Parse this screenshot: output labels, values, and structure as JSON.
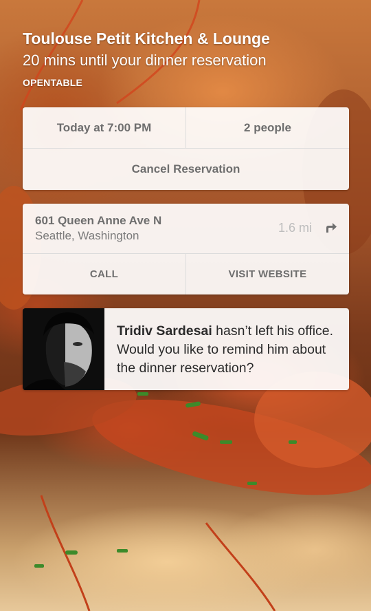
{
  "header": {
    "title": "Toulouse Petit Kitchen & Lounge",
    "subtitle": "20 mins until your dinner reservation",
    "source": "OPENTABLE"
  },
  "reservation": {
    "time": "Today at 7:00 PM",
    "party": "2 people",
    "cancel_label": "Cancel Reservation"
  },
  "location": {
    "street": "601 Queen Anne Ave N",
    "city": "Seattle, Washington",
    "distance": "1.6 mi",
    "directions_icon": "directions-arrow-icon",
    "call_label": "CALL",
    "website_label": "VISIT WEBSITE"
  },
  "reminder": {
    "name": "Tridiv Sardesai",
    "message": " hasn’t left his office. Would you like to remind him about the dinner reservation?",
    "avatar_icon": "contact-photo"
  },
  "colors": {
    "card_bg": "#ffffff",
    "label_gray": "#6e6e6e",
    "muted_gray": "#bdbdbd"
  }
}
